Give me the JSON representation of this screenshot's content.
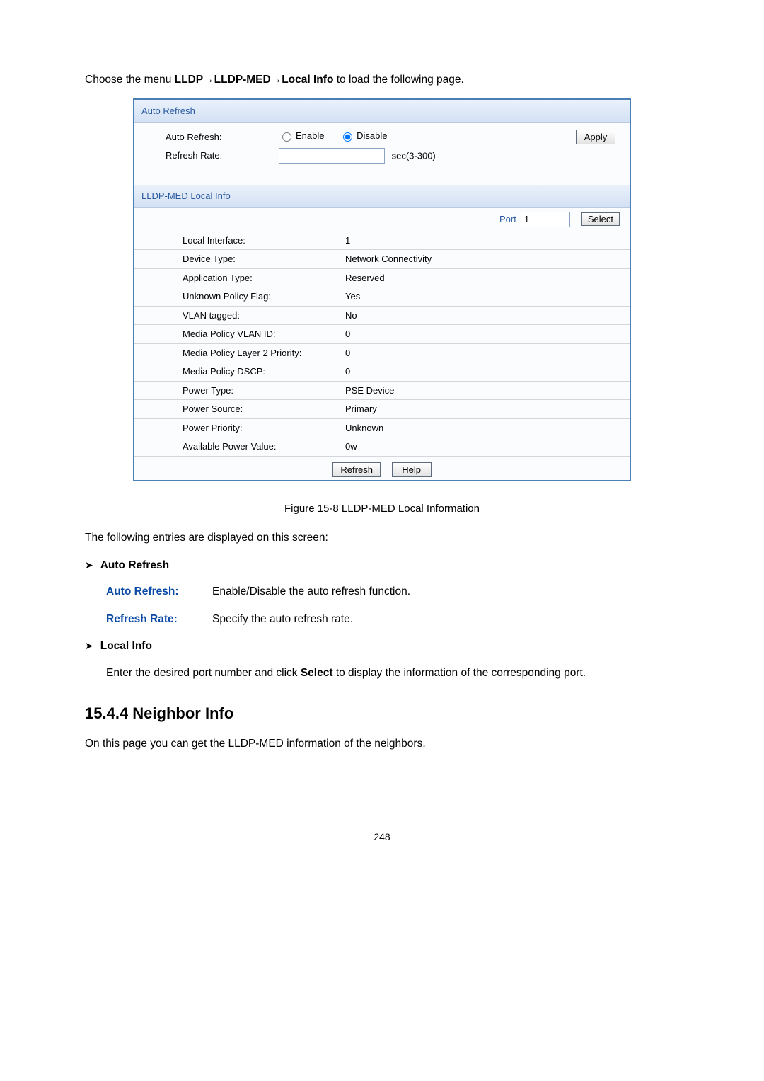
{
  "intro": {
    "prefix": "Choose the menu ",
    "menu": "LLDP→LLDP-MED→Local Info",
    "suffix": " to load the following page."
  },
  "panel": {
    "autoRefresh": {
      "header": "Auto Refresh",
      "label": "Auto Refresh:",
      "enable": "Enable",
      "disable": "Disable",
      "rateLabel": "Refresh Rate:",
      "rateValue": "",
      "rateUnit": "sec(3-300)",
      "apply": "Apply"
    },
    "localInfo": {
      "header": "LLDP-MED Local Info",
      "portLabel": "Port",
      "portValue": "1",
      "select": "Select",
      "rows": [
        {
          "k": "Local Interface:",
          "v": "1"
        },
        {
          "k": "Device Type:",
          "v": "Network Connectivity"
        },
        {
          "k": "Application Type:",
          "v": "Reserved"
        },
        {
          "k": "Unknown Policy Flag:",
          "v": "Yes"
        },
        {
          "k": "VLAN tagged:",
          "v": "No"
        },
        {
          "k": "Media Policy VLAN ID:",
          "v": "0"
        },
        {
          "k": "Media Policy Layer 2 Priority:",
          "v": "0"
        },
        {
          "k": "Media Policy DSCP:",
          "v": "0"
        },
        {
          "k": "Power Type:",
          "v": "PSE Device"
        },
        {
          "k": "Power Source:",
          "v": "Primary"
        },
        {
          "k": "Power Priority:",
          "v": "Unknown"
        },
        {
          "k": "Available Power Value:",
          "v": "0w"
        }
      ],
      "refresh": "Refresh",
      "help": "Help"
    }
  },
  "figure": "Figure 15-8 LLDP-MED Local Information",
  "entriesText": "The following entries are displayed on this screen:",
  "bullets": {
    "autoRefresh": "Auto Refresh",
    "localInfo": "Local Info"
  },
  "defs": {
    "ar": {
      "term": "Auto Refresh:",
      "desc": "Enable/Disable the auto refresh function."
    },
    "rr": {
      "term": "Refresh Rate:",
      "desc": "Specify the auto refresh rate."
    }
  },
  "localInfoText": {
    "pre": "Enter the desired port number and click ",
    "bold": "Select",
    "post": " to display the information of the corresponding port."
  },
  "neighbor": {
    "heading": "15.4.4  Neighbor Info",
    "text": "On this page you can get the LLDP-MED information of the neighbors."
  },
  "pageNumber": "248"
}
